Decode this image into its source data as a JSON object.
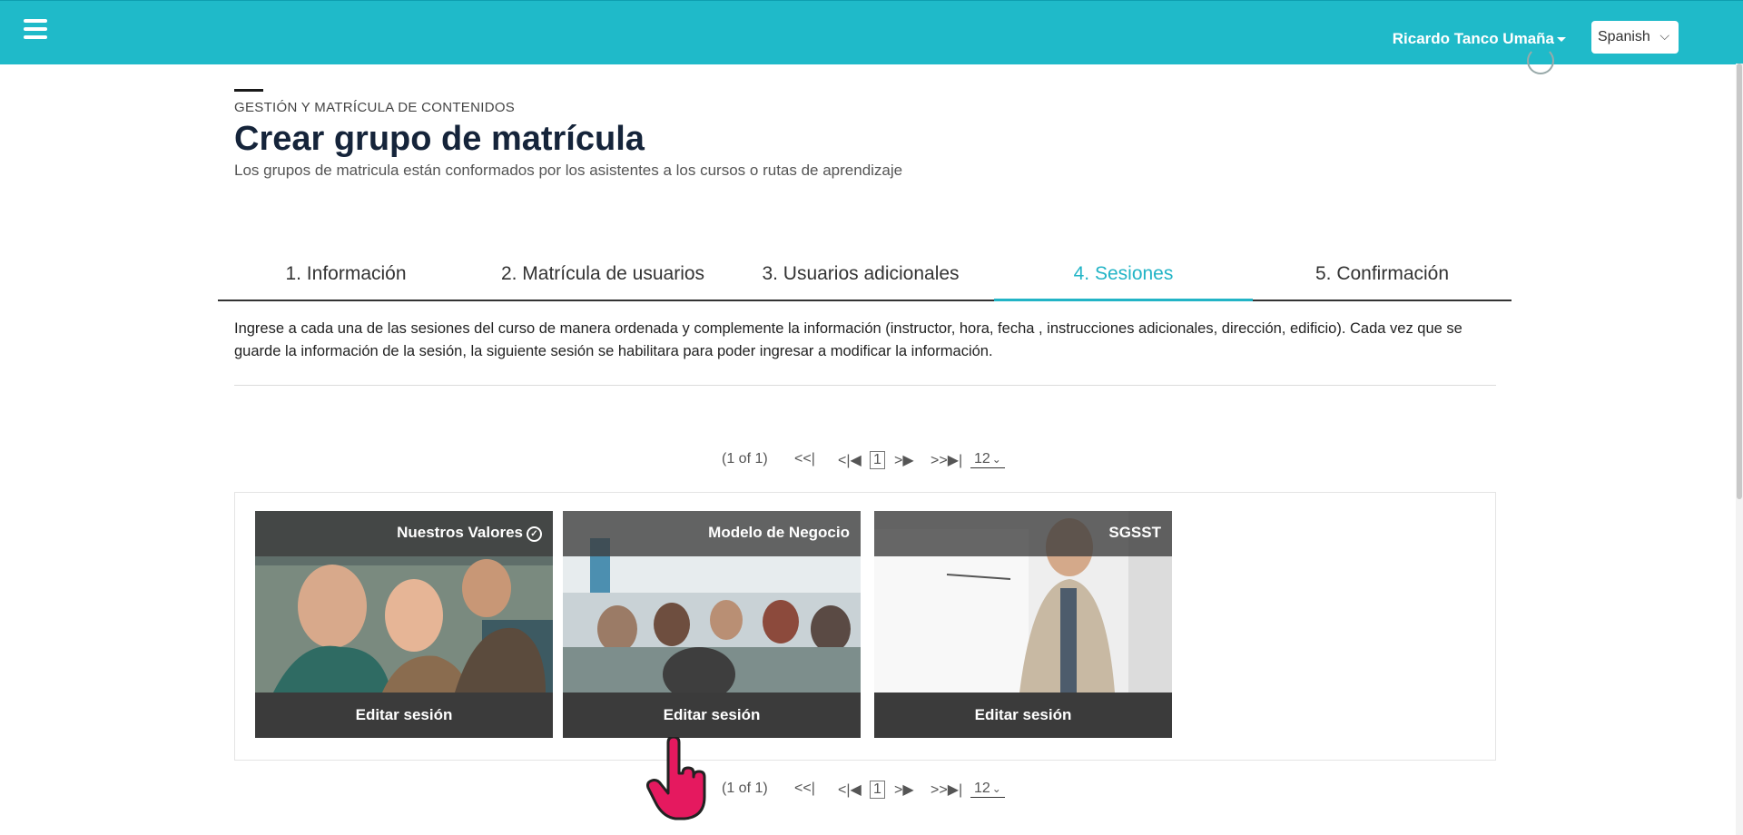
{
  "topbar": {
    "menu_icon": "hamburger-menu-icon",
    "user_name": "Ricardo Tanco Umaña",
    "language": "Spanish"
  },
  "header": {
    "section": "GESTIÓN Y MATRÍCULA DE CONTENIDOS",
    "title": "Crear grupo de matrícula",
    "subtitle": "Los grupos de matricula están conformados por los asistentes a los cursos o rutas de aprendizaje"
  },
  "tabs": [
    {
      "label": "1. Información"
    },
    {
      "label": "2. Matrícula de usuarios"
    },
    {
      "label": "3. Usuarios adicionales"
    },
    {
      "label": "4. Sesiones",
      "active": true
    },
    {
      "label": "5. Confirmación"
    }
  ],
  "instructions": "Ingrese a cada una de las sesiones del curso de manera ordenada y complemente la información (instructor, hora, fecha , instrucciones adicionales, dirección, edificio). Cada vez que se guarde la información de la sesión, la siguiente sesión se habilitara para poder ingresar a modificar la información.",
  "pagination": {
    "info": "(1 of 1)",
    "first": "<<",
    "prev": "<",
    "page": "1",
    "next": ">",
    "last": ">>",
    "page_size": "12"
  },
  "sessions": [
    {
      "title": "Nuestros Valores",
      "completed": true,
      "button": "Editar sesión"
    },
    {
      "title": "Modelo de Negocio",
      "completed": false,
      "button": "Editar sesión"
    },
    {
      "title": "SGSST",
      "completed": false,
      "button": "Editar sesión"
    }
  ],
  "colors": {
    "topbar": "#1fbac9",
    "active_tab": "#22b4c6",
    "card_bar": "#3b3b3b"
  }
}
